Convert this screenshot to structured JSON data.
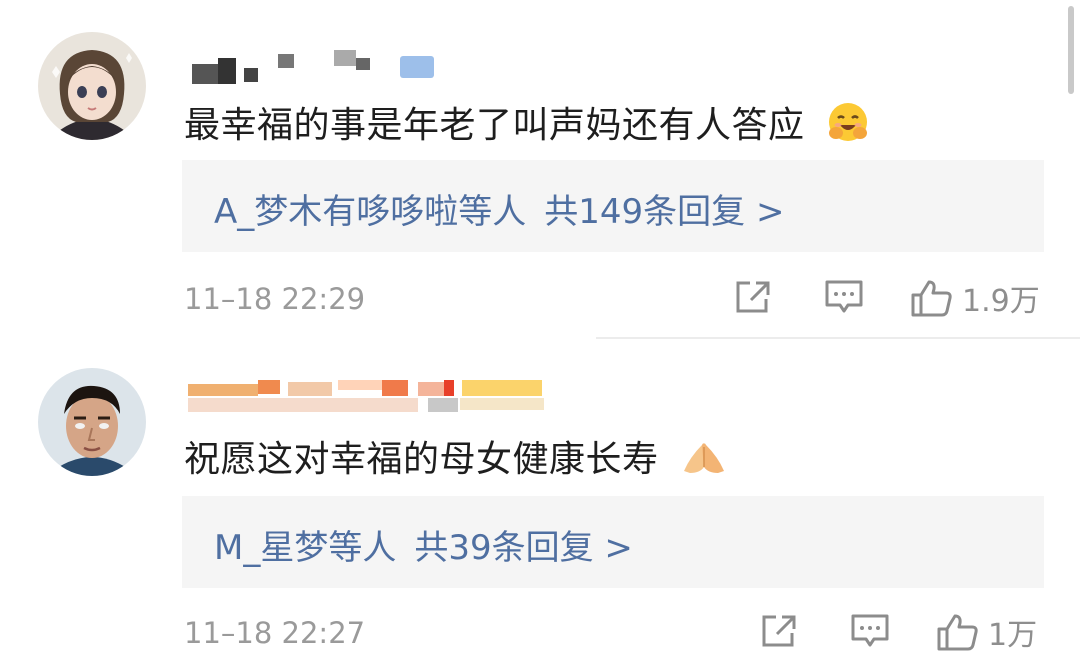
{
  "comments": [
    {
      "text": "最幸福的事是年老了叫声妈还有人答应",
      "emoji": "smiling-face-with-open-hands",
      "replies": {
        "users": "A_梦木有哆哆啦等人",
        "count": "共149条回复 >"
      },
      "time": "11–18 22:29",
      "likes": "1.9万"
    },
    {
      "text": "祝愿这对幸福的母女健康长寿",
      "emoji": "folded-hands",
      "replies": {
        "users": "M_星梦等人",
        "count": "共39条回复 >"
      },
      "time": "11–18 22:27",
      "likes": "1万"
    }
  ],
  "colors": {
    "link": "#4f6fa1",
    "meta": "#9a9a9a",
    "reply_bg": "#f5f5f5"
  }
}
